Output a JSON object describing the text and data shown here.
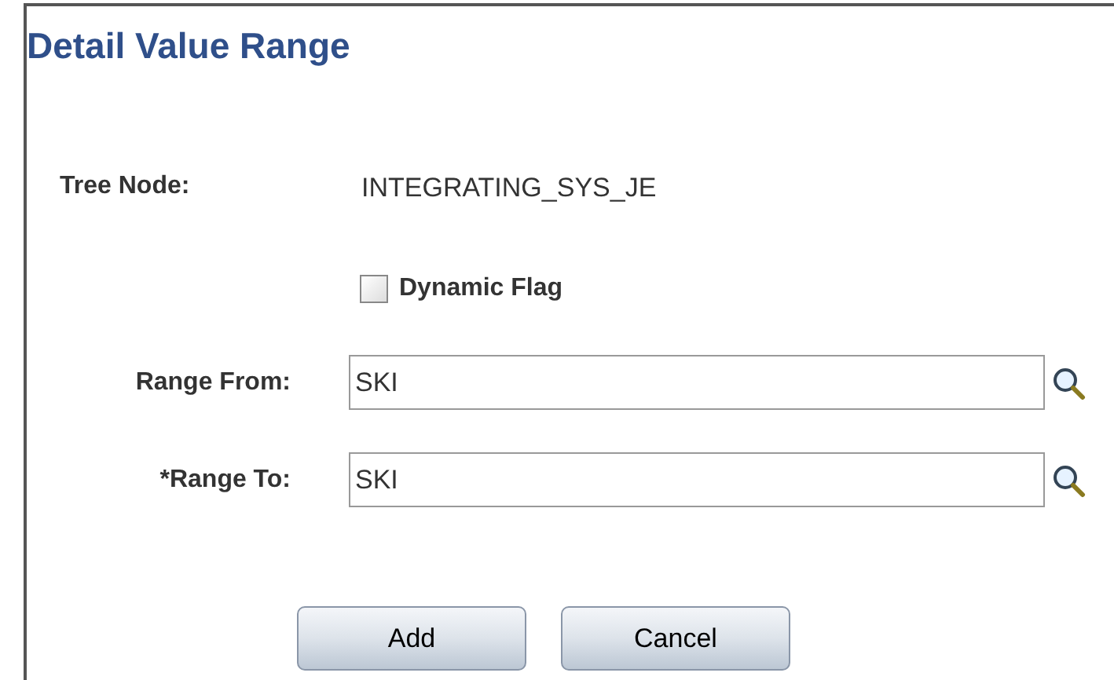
{
  "title": "Detail Value Range",
  "tree_node": {
    "label": "Tree Node:",
    "value": "INTEGRATING_SYS_JE"
  },
  "dynamic_flag": {
    "label": "Dynamic Flag",
    "checked": false
  },
  "fields": [
    {
      "label": "Range From:",
      "value": "SKI"
    },
    {
      "label": "*Range To:",
      "value": "SKI"
    }
  ],
  "buttons": [
    "Add",
    "Cancel"
  ]
}
